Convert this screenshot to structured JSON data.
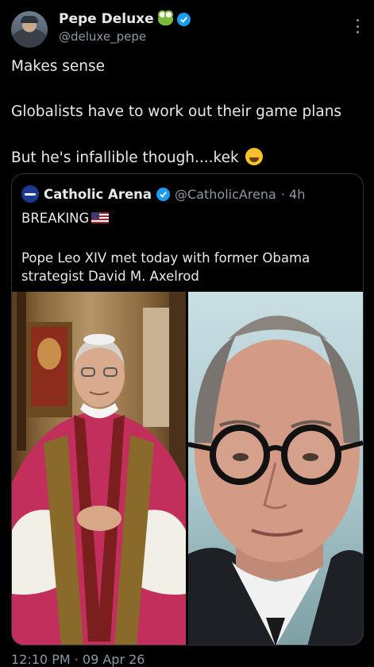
{
  "post": {
    "author": {
      "display_name": "Pepe Deluxe",
      "handle": "@deluxe_pepe",
      "name_emoji": "frog-face-icon",
      "verified": true
    },
    "text_lines": [
      "Makes sense",
      "Globalists have to work out their game plans",
      "But he's infallible though....kek"
    ],
    "trailing_emoji": "rolling-on-floor-laughing-icon",
    "timestamp": "12:10 PM · 09 Apr 26"
  },
  "quoted": {
    "display_name": "Catholic Arena",
    "handle": "@CatholicArena",
    "age": "· 4h",
    "lines": [
      "BREAKING",
      "Pope Leo XIV met today with former Obama",
      "strategist David M. Axelrod"
    ],
    "flag_emoji": "us-flag-icon",
    "media": [
      {
        "name": "pope-photo",
        "description_icon": "photo"
      },
      {
        "name": "axelrod-photo",
        "description_icon": "photo"
      }
    ]
  },
  "colors": {
    "background": "#000000",
    "text": "#e7e9ea",
    "secondary": "#8b98a5",
    "verified": "#1d9bf0",
    "border": "#2f3336"
  }
}
